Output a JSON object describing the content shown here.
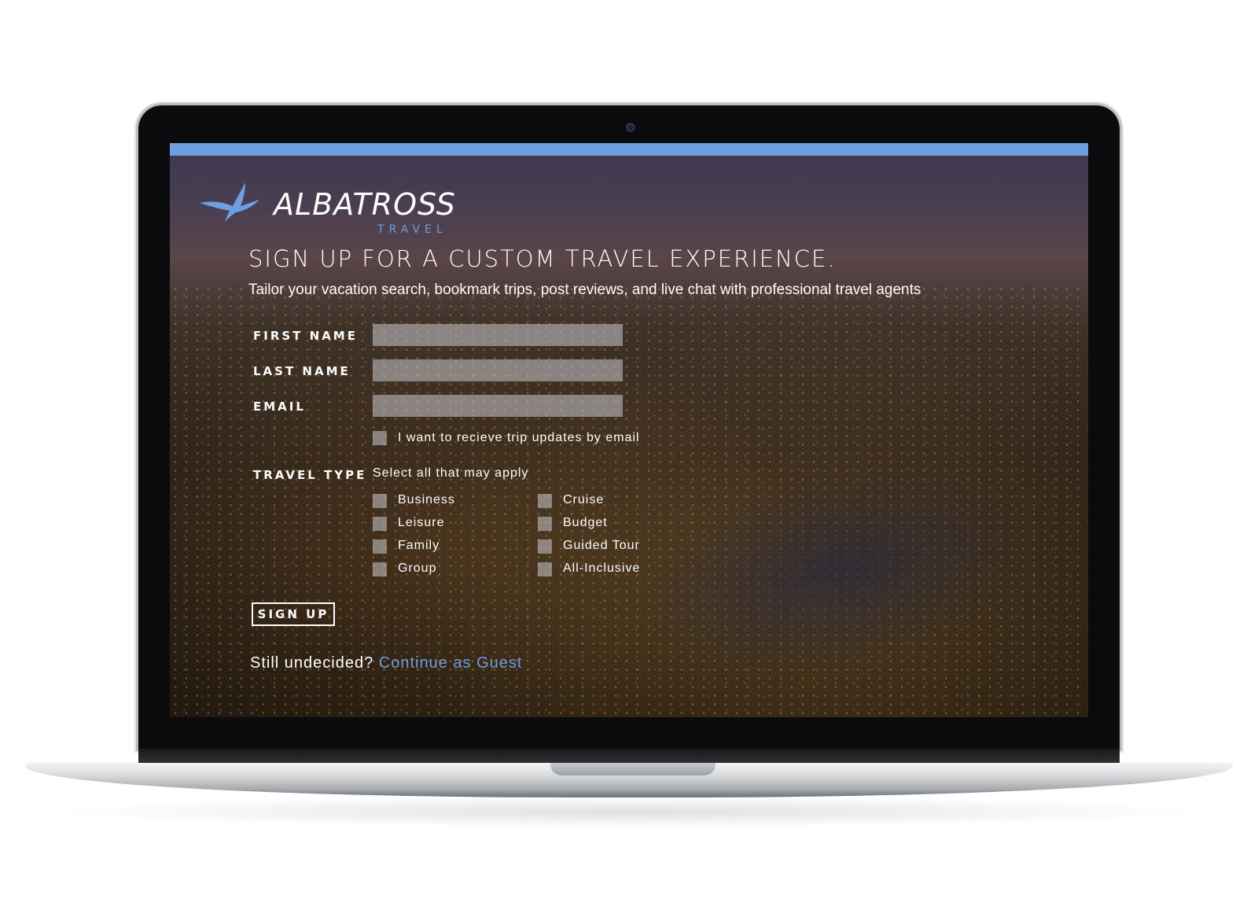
{
  "brand": {
    "name": "ALBATROSS",
    "sub": "TRAVEL",
    "accent_color": "#6d9ee0"
  },
  "hero": {
    "headline": "SIGN UP FOR A CUSTOM TRAVEL EXPERIENCE.",
    "subline": "Tailor your vacation search, bookmark trips, post reviews, and live chat with professional travel agents"
  },
  "form": {
    "first_name_label": "FIRST NAME",
    "first_name_value": "",
    "last_name_label": "LAST NAME",
    "last_name_value": "",
    "email_label": "EMAIL",
    "email_value": "",
    "updates_label": "I want to recieve trip updates by email",
    "travel_type_label": "TRAVEL TYPE",
    "travel_type_helper": "Select all that may apply",
    "travel_types_left": [
      "Business",
      "Leisure",
      "Family",
      "Group"
    ],
    "travel_types_right": [
      "Cruise",
      "Budget",
      "Guided Tour",
      "All-Inclusive"
    ],
    "submit_label": "SIGN UP"
  },
  "footer": {
    "prompt": "Still undecided?",
    "guest_link": "Continue as Guest"
  },
  "icons": {
    "logo": "albatross-bird-icon"
  }
}
